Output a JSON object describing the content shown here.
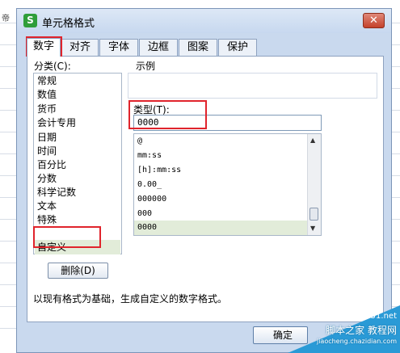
{
  "background": {
    "cell_text": "帝"
  },
  "dialog": {
    "title": "单元格格式",
    "app_icon": "S",
    "close_glyph": "✕"
  },
  "tabs": [
    {
      "label": "数字",
      "active": true
    },
    {
      "label": "对齐",
      "active": false
    },
    {
      "label": "字体",
      "active": false
    },
    {
      "label": "边框",
      "active": false
    },
    {
      "label": "图案",
      "active": false
    },
    {
      "label": "保护",
      "active": false
    }
  ],
  "category": {
    "label": "分类(C):",
    "items": [
      "常规",
      "数值",
      "货币",
      "会计专用",
      "日期",
      "时间",
      "百分比",
      "分数",
      "科学记数",
      "文本",
      "特殊",
      "自定义"
    ],
    "selected": "自定义"
  },
  "sample": {
    "label": "示例"
  },
  "type": {
    "label": "类型(T):",
    "value": "0000",
    "list": [
      "@",
      "mm:ss",
      "[h]:mm:ss",
      "0.00_",
      "000000",
      "000",
      "0000"
    ],
    "selected": "0000"
  },
  "buttons": {
    "delete": "删除(D)",
    "ok": "确定"
  },
  "description": "以现有格式为基础，生成自定义的数字格式。",
  "watermark": {
    "line1": "脚本之家  教程网",
    "line2": "jiaocheng.chazidian.com",
    "domain": "jb51.net"
  },
  "colors": {
    "annotation": "#e0242c",
    "selection": "#e2ecd9",
    "dialog_bg": "#c9d9ee"
  }
}
